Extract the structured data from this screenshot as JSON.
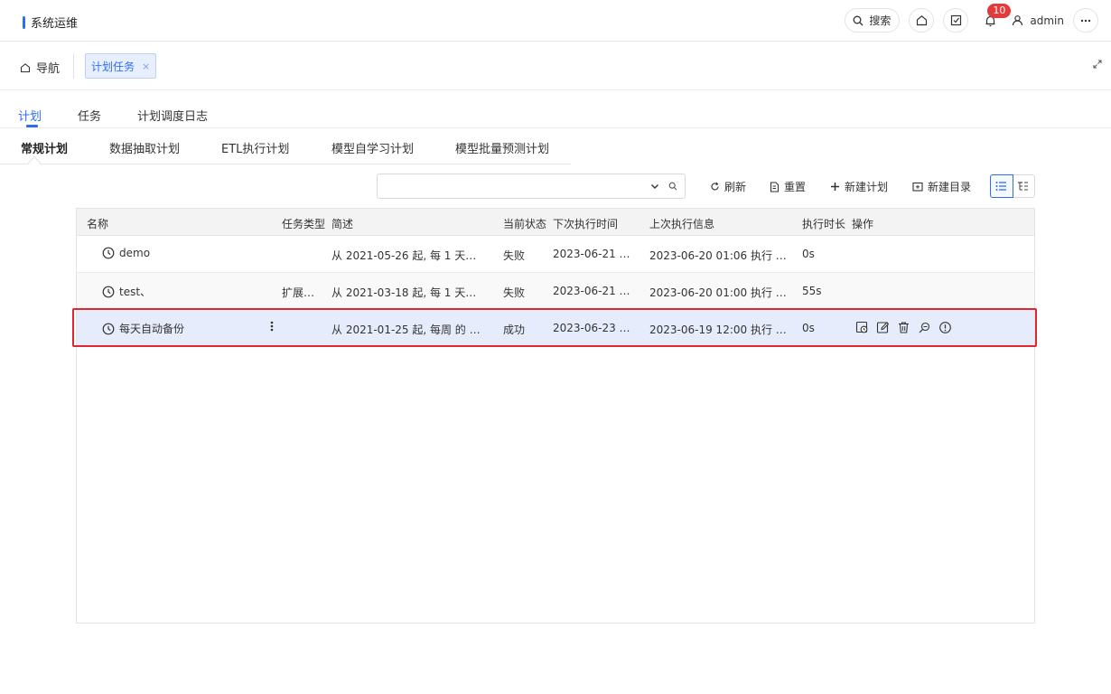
{
  "header": {
    "title": "系统运维",
    "search_label": "搜索",
    "notification_count": "10",
    "username": "admin",
    "brand_color": "#2f6cf6"
  },
  "navbar": {
    "home_label": "导航",
    "open_tab_label": "计划任务",
    "close_glyph": "×"
  },
  "main_tabs": [
    {
      "label": "计划",
      "active": true
    },
    {
      "label": "任务",
      "active": false
    },
    {
      "label": "计划调度日志",
      "active": false
    }
  ],
  "sub_tabs": [
    {
      "label": "常规计划",
      "active": true
    },
    {
      "label": "数据抽取计划",
      "active": false
    },
    {
      "label": "ETL执行计划",
      "active": false
    },
    {
      "label": "模型自学习计划",
      "active": false
    },
    {
      "label": "模型批量预测计划",
      "active": false
    }
  ],
  "toolbar": {
    "search_value": "",
    "refresh_label": "刷新",
    "reset_label": "重置",
    "new_plan_label": "新建计划",
    "new_dir_label": "新建目录",
    "view_mode": "list"
  },
  "table": {
    "columns": [
      "名称",
      "任务类型",
      "简述",
      "当前状态",
      "下次执行时间",
      "上次执行信息",
      "执行时长",
      "操作"
    ],
    "rows": [
      {
        "name": "demo",
        "type": "",
        "desc": "从 2021-05-26 起, 每 1 天…",
        "status": "失败",
        "next": "2023-06-21 …",
        "last": "2023-06-20 01:06 执行 …",
        "duration": "0s",
        "selected": false
      },
      {
        "name": "test、",
        "type": "扩展…",
        "desc": "从 2021-03-18 起, 每 1 天…",
        "status": "失败",
        "next": "2023-06-21 …",
        "last": "2023-06-20 01:00 执行 …",
        "duration": "55s",
        "selected": false
      },
      {
        "name": "每天自动备份",
        "type": "",
        "desc": "从 2021-01-25 起, 每周 的 …",
        "status": "成功",
        "next": "2023-06-23 …",
        "last": "2023-06-19 12:00 执行 …",
        "duration": "0s",
        "selected": true
      }
    ],
    "row_actions": [
      "history-icon",
      "edit-icon",
      "delete-icon",
      "search-log-icon",
      "info-icon"
    ]
  },
  "highlight_color": "#e0262e"
}
